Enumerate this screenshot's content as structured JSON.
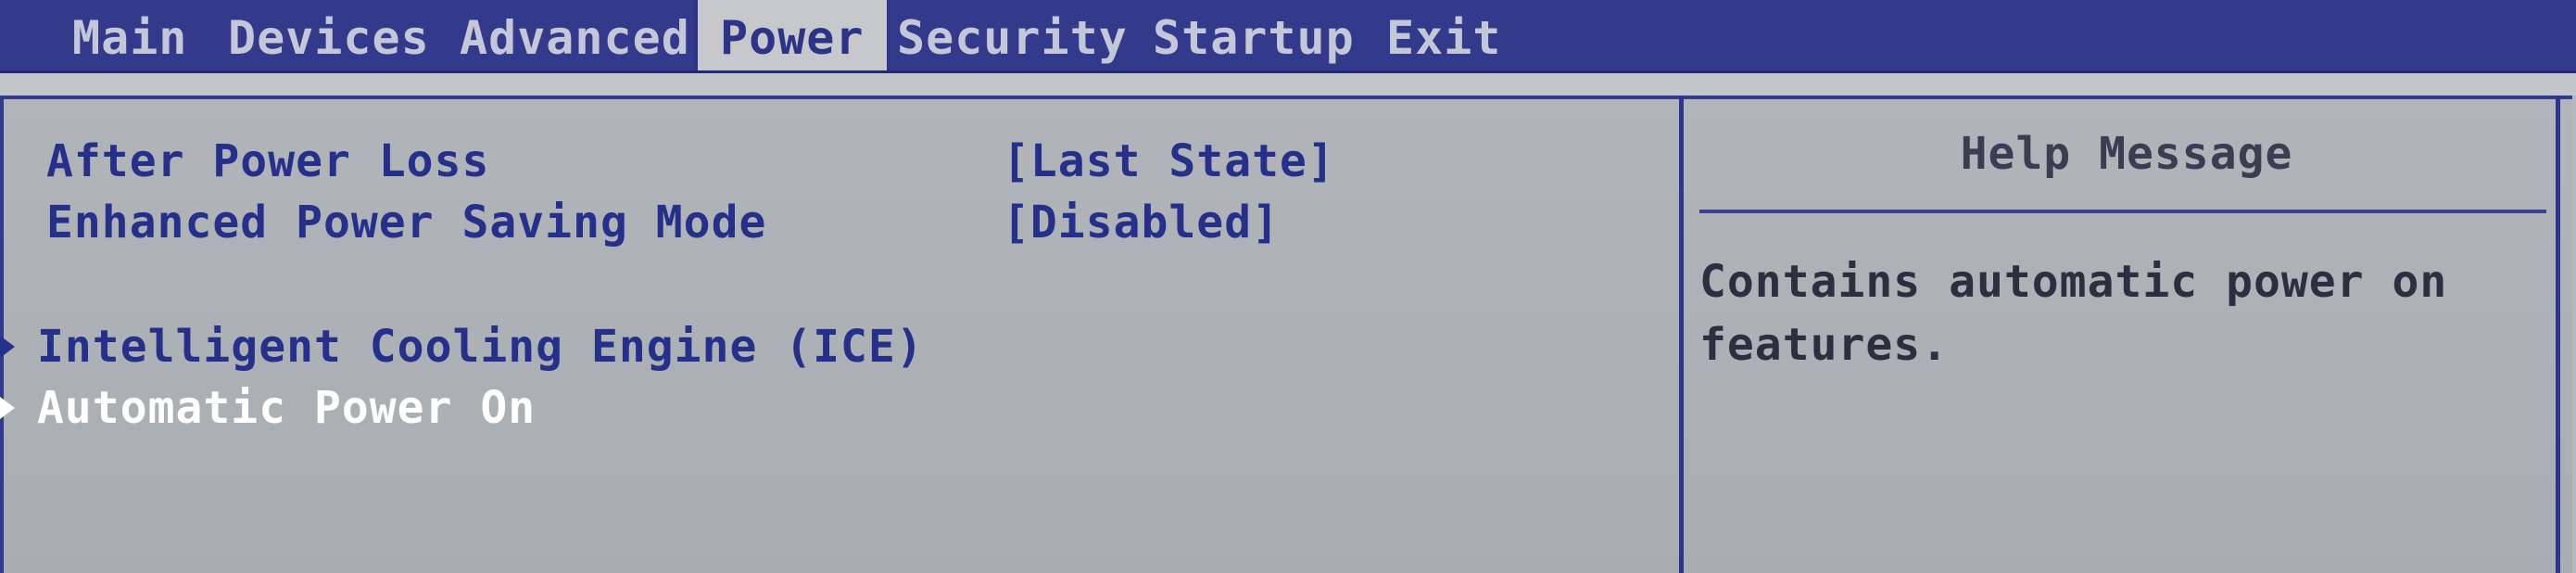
{
  "menu": {
    "items": [
      {
        "label": "Main"
      },
      {
        "label": "Devices"
      },
      {
        "label": "Advanced"
      },
      {
        "label": "Power"
      },
      {
        "label": "Security"
      },
      {
        "label": "Startup"
      },
      {
        "label": "Exit"
      }
    ],
    "active": "Power"
  },
  "settings": [
    {
      "label": "After Power Loss",
      "value": "[Last State]"
    },
    {
      "label": "Enhanced Power Saving Mode",
      "value": "[Disabled]"
    }
  ],
  "submenus": [
    {
      "label": "Intelligent Cooling Engine (ICE)",
      "selected": false
    },
    {
      "label": "Automatic Power On",
      "selected": true
    }
  ],
  "help": {
    "title": "Help Message",
    "text": "Contains automatic power on features."
  },
  "colors": {
    "menubar": "#333a8c",
    "panel": "#b1b5ba",
    "text": "#25308a",
    "selected": "#ffffff"
  }
}
